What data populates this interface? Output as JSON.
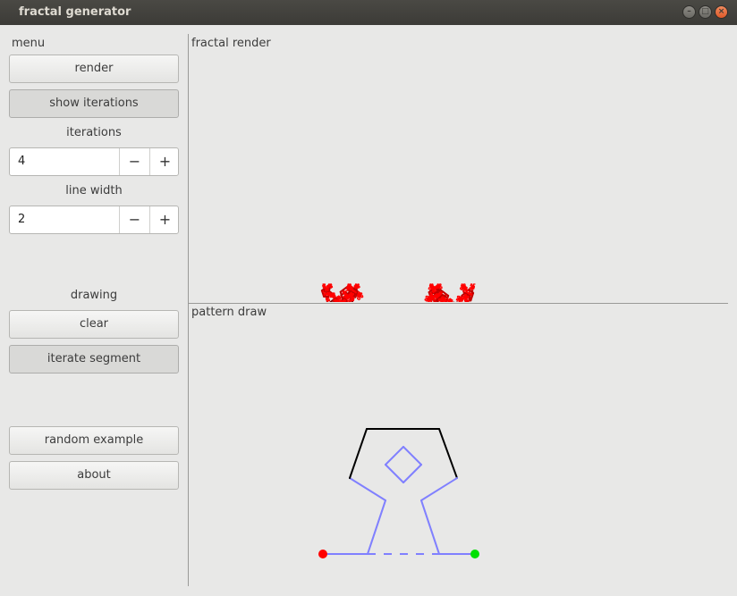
{
  "window": {
    "title": "fractal generator"
  },
  "menu": {
    "heading": "menu",
    "render_label": "render",
    "show_iterations_label": "show iterations",
    "iterations_heading": "iterations",
    "iterations_value": "4",
    "line_width_heading": "line width",
    "line_width_value": "2",
    "minus_glyph": "−",
    "plus_glyph": "+"
  },
  "drawing": {
    "heading": "drawing",
    "clear_label": "clear",
    "iterate_segment_label": "iterate segment"
  },
  "extras": {
    "random_example_label": "random example",
    "about_label": "about"
  },
  "panels": {
    "fractal_render_label": "fractal render",
    "pattern_draw_label": "pattern draw"
  },
  "colors": {
    "fractal_root": "#000000",
    "fractal_tip": "#ff0000",
    "pattern_line": "#8080ff",
    "pattern_base": "#000000",
    "start_point": "#ff0000",
    "end_point": "#00e000"
  }
}
